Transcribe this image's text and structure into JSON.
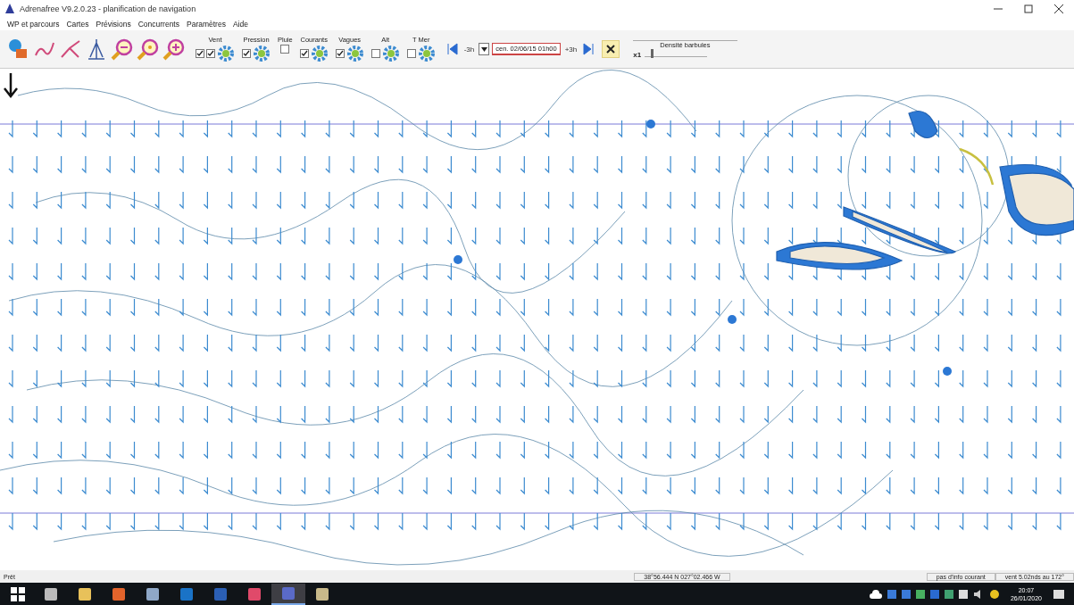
{
  "window": {
    "title": "Adrenafree V9.2.0.23 - planification de navigation"
  },
  "menu": [
    "WP et parcours",
    "Cartes",
    "Prévisions",
    "Concurrents",
    "Paramètres",
    "Aide"
  ],
  "layers": [
    {
      "label": "Vent",
      "kind": "gear",
      "checks": [
        true,
        true
      ]
    },
    {
      "label": "Pression",
      "kind": "gear",
      "checks": [
        true
      ]
    },
    {
      "label": "Pluie",
      "kind": "plain",
      "checks": [
        false
      ]
    },
    {
      "label": "Courants",
      "kind": "gear",
      "checks": [
        true
      ]
    },
    {
      "label": "Vagues",
      "kind": "gear",
      "checks": [
        true
      ]
    },
    {
      "label": "Alt",
      "kind": "gear",
      "checks": [
        false
      ]
    },
    {
      "label": "T Mer",
      "kind": "gear",
      "checks": [
        false
      ]
    }
  ],
  "time_nav": {
    "back": "-3h",
    "date": "cen. 02/06/15 01h00",
    "forward": "+3h"
  },
  "density": {
    "label": "Densité barbules",
    "value": "x1",
    "level": 0.1
  },
  "status_bar": {
    "state": "Prêt",
    "position": "38°56.444 N 027°02.466 W",
    "current": "pas d'info courant",
    "wind": "vent 5.02nds au 172°"
  },
  "taskbar": {
    "apps": [
      {
        "kind": "task-view",
        "selected": false
      },
      {
        "kind": "folder",
        "selected": false
      },
      {
        "kind": "browser",
        "selected": false
      },
      {
        "kind": "document",
        "selected": false
      },
      {
        "kind": "mail",
        "selected": false
      },
      {
        "kind": "word",
        "selected": false
      },
      {
        "kind": "music",
        "selected": false
      },
      {
        "kind": "sail",
        "selected": true
      },
      {
        "kind": "picture",
        "selected": false
      }
    ],
    "time": "20:07",
    "date": "26/01/2020"
  }
}
